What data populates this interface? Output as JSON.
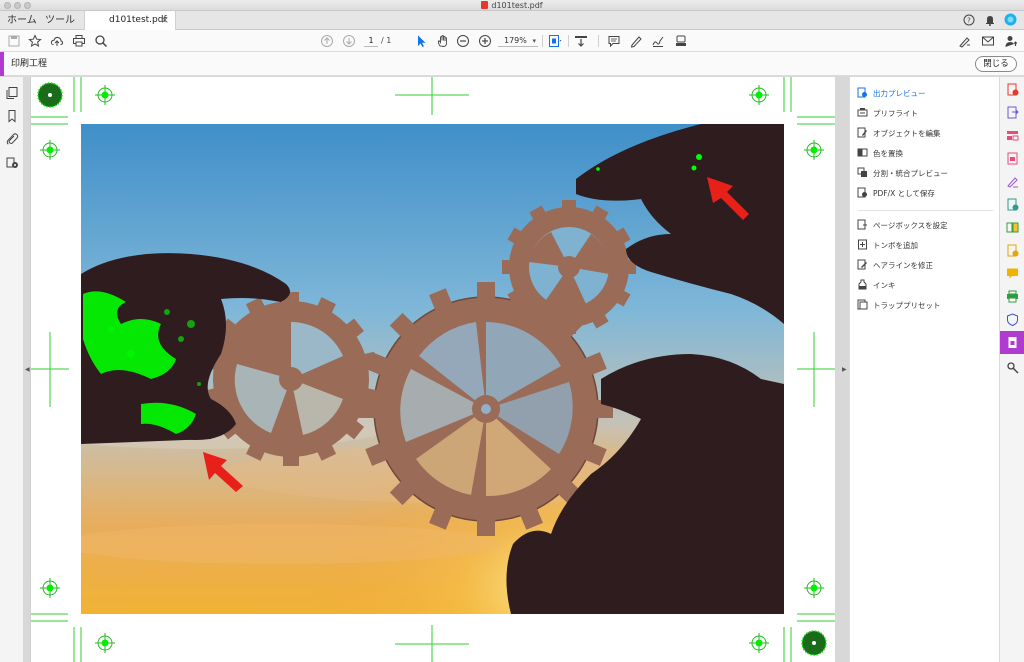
{
  "window": {
    "title": "d101test.pdf"
  },
  "tabs": {
    "home": "ホーム",
    "tools": "ツール",
    "document": "d101test.pdf",
    "close_symbol": "×"
  },
  "toolbar": {
    "page_current": "1",
    "page_total": "/ 1",
    "zoom": "179%",
    "zoom_caret": "▾"
  },
  "tool_header": {
    "title": "印刷工程",
    "close_label": "閉じる"
  },
  "right_panel": {
    "items": [
      {
        "label": "出力プレビュー",
        "icon": "output-preview-icon",
        "active": true
      },
      {
        "label": "プリフライト",
        "icon": "preflight-icon"
      },
      {
        "label": "オブジェクトを編集",
        "icon": "edit-object-icon"
      },
      {
        "label": "色を置換",
        "icon": "replace-color-icon"
      },
      {
        "label": "分割・統合プレビュー",
        "icon": "flattener-preview-icon"
      },
      {
        "label": "PDF/X として保存",
        "icon": "save-pdfx-icon"
      },
      {
        "label": "ページボックスを設定",
        "icon": "set-page-boxes-icon"
      },
      {
        "label": "トンボを追加",
        "icon": "add-printer-marks-icon"
      },
      {
        "label": "ヘアラインを修正",
        "icon": "fix-hairlines-icon"
      },
      {
        "label": "インキ",
        "icon": "ink-icon"
      },
      {
        "label": "トラッププリセット",
        "icon": "trap-presets-icon"
      }
    ]
  },
  "colors": {
    "accent": "#b03ccf",
    "link_blue": "#1473e6",
    "highlight_green": "#00ff00",
    "crop_mark_green": "#22cc22",
    "arrow_red": "#e8201a"
  }
}
